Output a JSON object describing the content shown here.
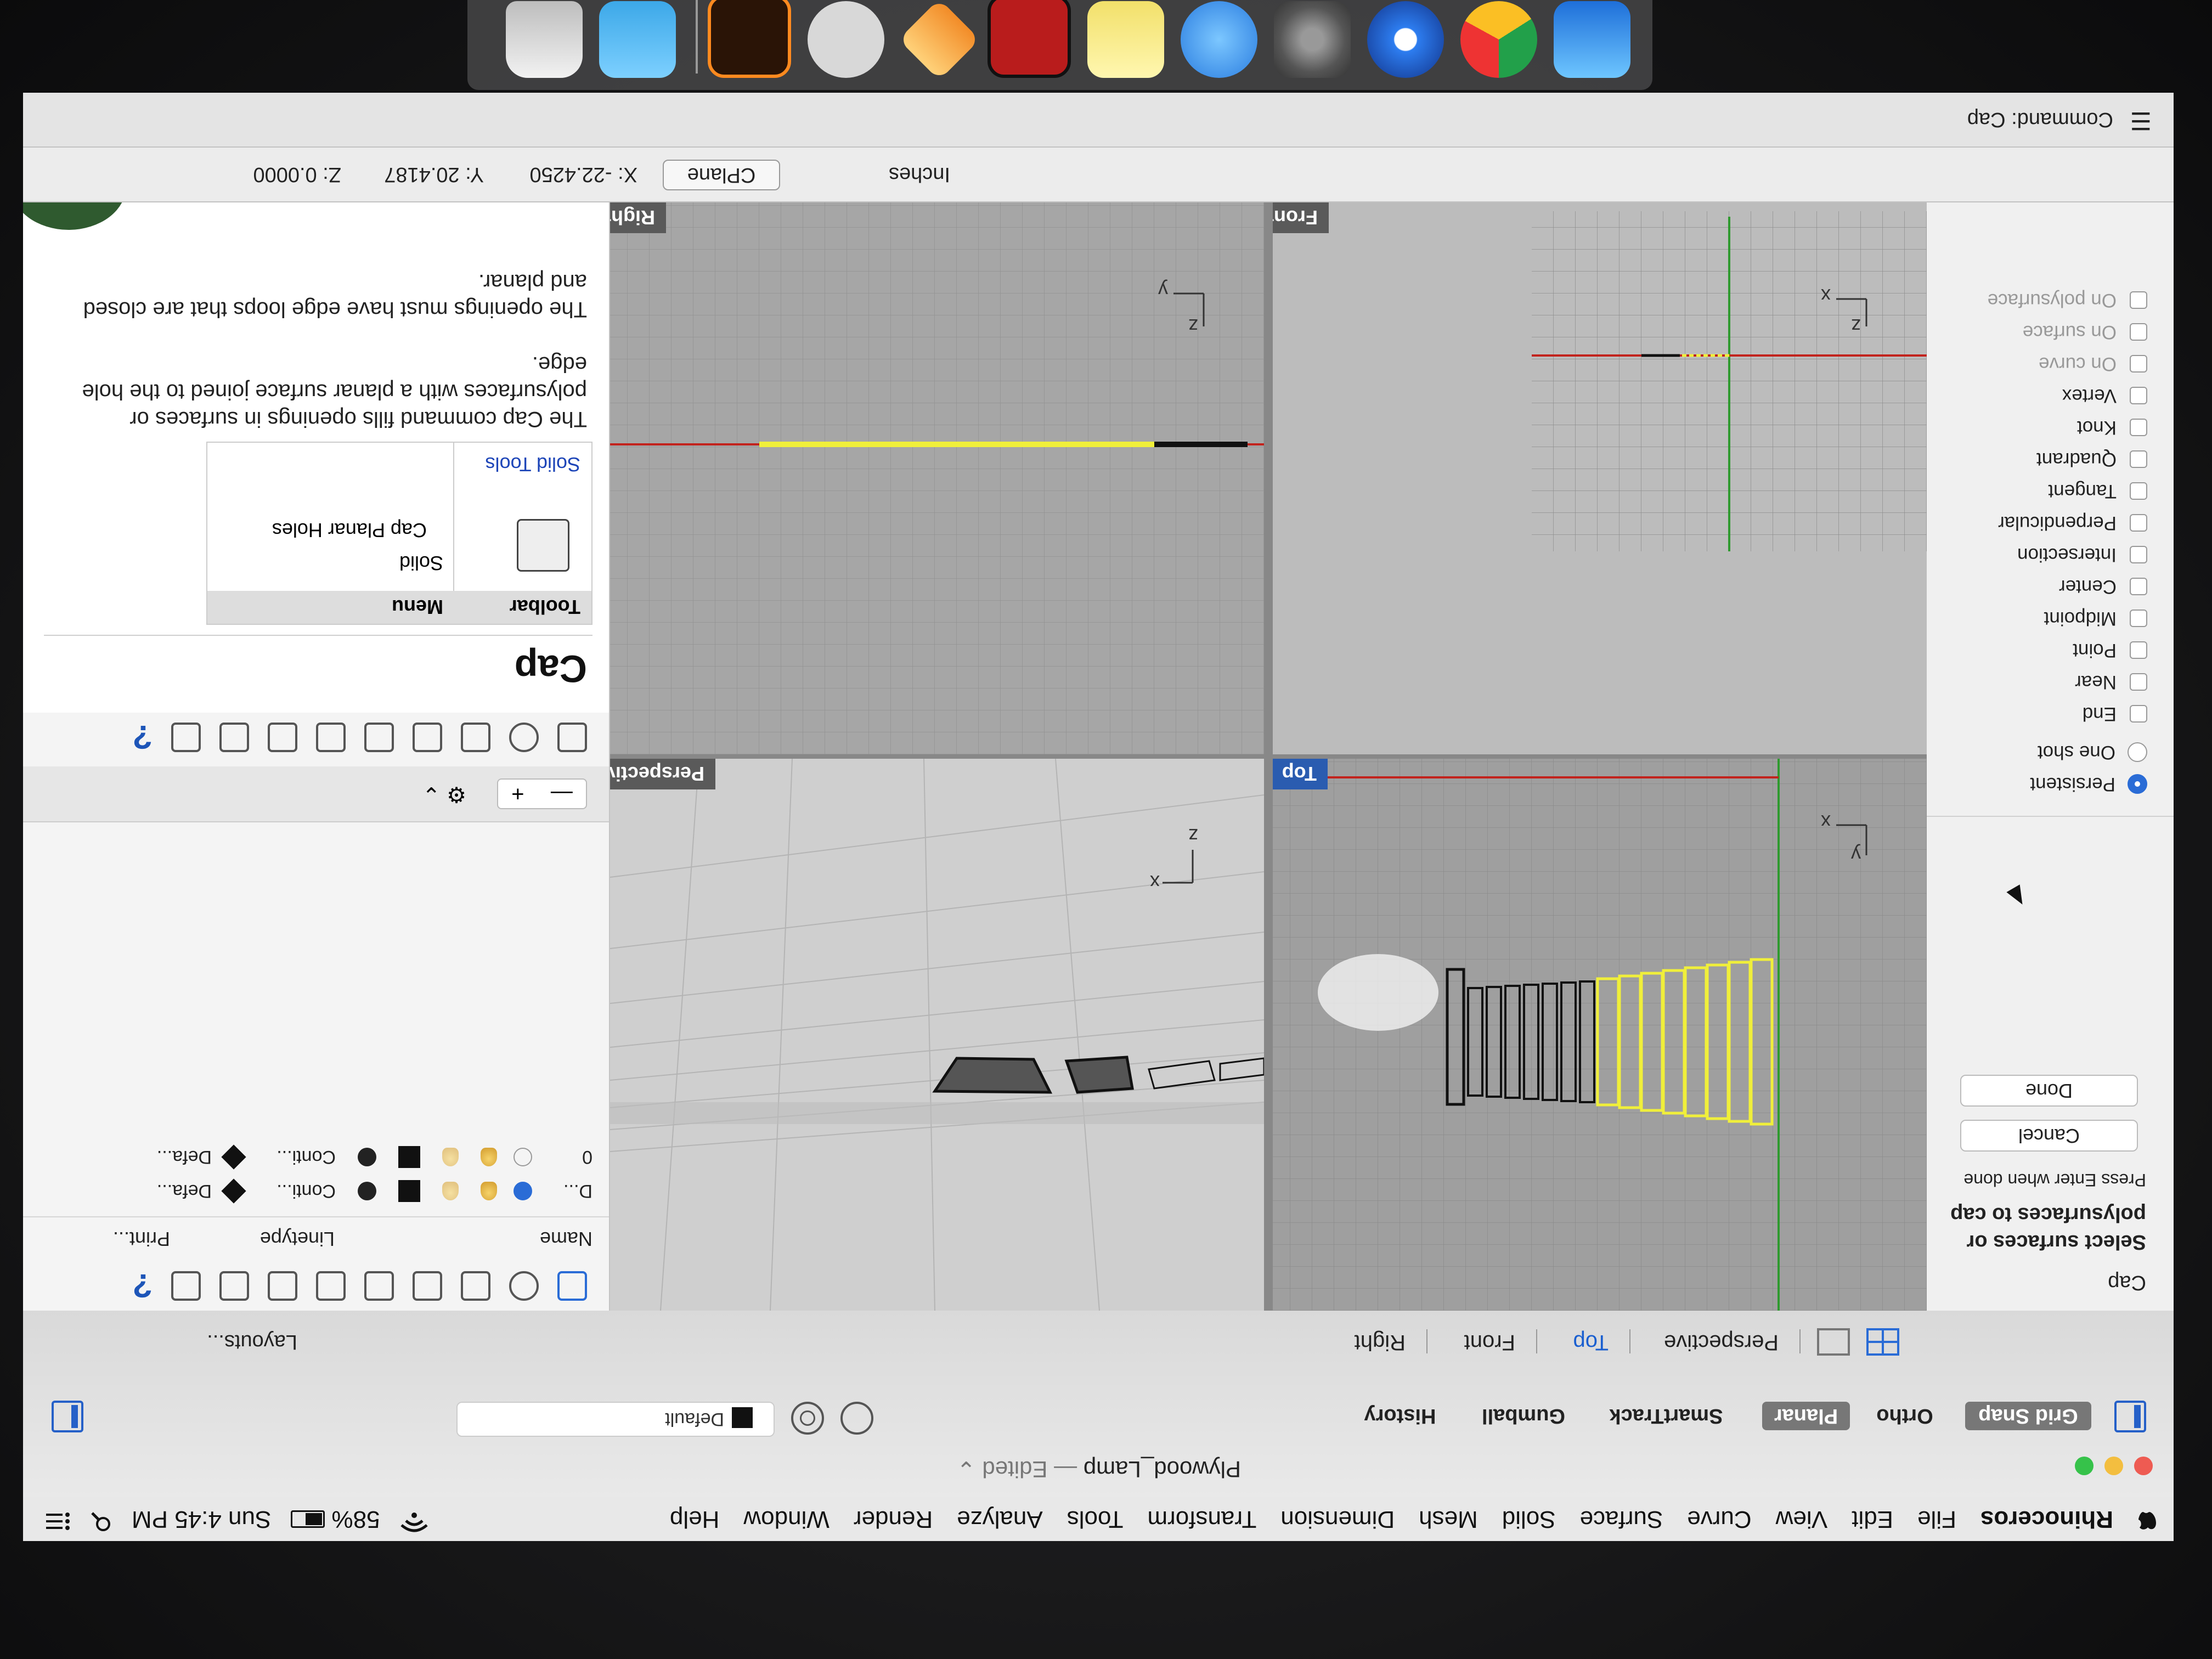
{
  "menubar": {
    "app_name": "Rhinoceros",
    "items": [
      "File",
      "Edit",
      "View",
      "Curve",
      "Surface",
      "Solid",
      "Mesh",
      "Dimension",
      "Transform",
      "Tools",
      "Analyze",
      "Render",
      "Window",
      "Help"
    ],
    "battery": "58%",
    "clock": "Sun 4:45 PM"
  },
  "window": {
    "title": "Plywood_Lamp",
    "edited": " — Edited ⌄"
  },
  "toolbar": {
    "grid_snap": "Grid Snap",
    "ortho": "Ortho",
    "planar": "Planar",
    "smarttrack": "SmartTrack",
    "gumball": "Gumball",
    "history": "History",
    "layer": "Default"
  },
  "viewport_tabs": {
    "items": [
      "Perspective",
      "Top",
      "Front",
      "Right"
    ],
    "selected": "Top",
    "layouts": "Layouts..."
  },
  "command_panel": {
    "command": "Cap",
    "prompt": "Select surfaces or polysurfaces to cap",
    "hint": "Press Enter when done",
    "cancel": "Cancel",
    "done": "Done",
    "snap_modes": [
      "Persistent",
      "One shot"
    ],
    "osnaps": [
      "End",
      "Near",
      "Point",
      "Midpoint",
      "Center",
      "Intersection",
      "Perpendicular",
      "Tangent",
      "Quadrant",
      "Knot",
      "Vertex"
    ],
    "osnaps_dim": [
      "On curve",
      "On surface",
      "On polysurface"
    ]
  },
  "viewports": {
    "top": "Top",
    "perspective": "Perspective",
    "front": "Front",
    "right": "Right",
    "ax_x": "x",
    "ax_y": "y",
    "ax_z": "z"
  },
  "layers_panel": {
    "col_name": "Name",
    "linetype": "Linetype",
    "print": "Print...",
    "rows": [
      {
        "name": "D...",
        "linetype": "Conti...",
        "print": "Defa..."
      },
      {
        "name": "0",
        "linetype": "Conti...",
        "print": "Defa..."
      }
    ],
    "add": "+",
    "remove": "—"
  },
  "help": {
    "title": "Cap",
    "col_toolbar": "Toolbar",
    "col_menu": "Menu",
    "menu_path_1": "Solid",
    "menu_path_2": "Cap Planar Holes",
    "toolbar_link": "Solid Tools",
    "body": "The Cap command fills openings in surfaces or polysurfaces with a planar surface joined to the hole edge.",
    "body2": "The openings must have edge loops that are closed and planar."
  },
  "status": {
    "units": "Inches",
    "cplane": "CPlane",
    "x": "X: -22.4250",
    "y": "Y: 20.4187",
    "z": "Z: 0.0000"
  },
  "command_line": "Command: Cap",
  "colors": {
    "selected": "#f0ef3a",
    "accent": "#2a6cd6",
    "x_axis": "#c2231d",
    "y_axis": "#2f9a2f"
  }
}
